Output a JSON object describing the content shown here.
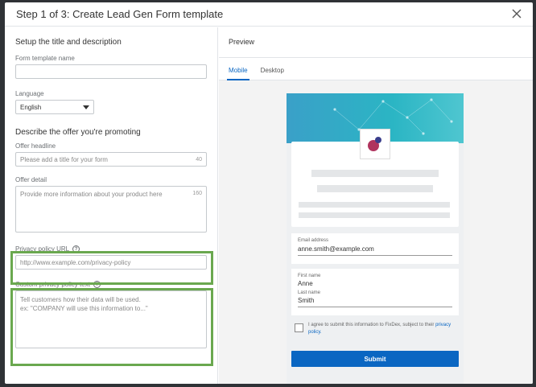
{
  "modal": {
    "title": "Step 1 of 3: Create Lead Gen Form template"
  },
  "left": {
    "section1_title": "Setup the title and description",
    "form_name_label": "Form template name",
    "form_name_value": "",
    "language_label": "Language",
    "language_value": "English",
    "section2_title": "Describe the offer you're promoting",
    "headline_label": "Offer headline",
    "headline_placeholder": "Please add a title for your form",
    "headline_counter": "40",
    "detail_label": "Offer detail",
    "detail_placeholder": "Provide more information about your product here",
    "detail_counter": "160",
    "privacy_url_label": "Privacy policy URL",
    "privacy_url_placeholder": "http://www.example.com/privacy-policy",
    "custom_privacy_label": "Custom privacy policy text",
    "custom_privacy_line1": "Tell customers how their data will be used.",
    "custom_privacy_line2": "ex: \"COMPANY will use this information to...\""
  },
  "preview": {
    "title": "Preview",
    "tabs": [
      "Mobile",
      "Desktop"
    ],
    "active_tab": "Mobile",
    "email_label": "Email address",
    "email_value": "anne.smith@example.com",
    "first_name_label": "First name",
    "first_name_value": "Anne",
    "last_name_label": "Last name",
    "last_name_value": "Smith",
    "consent_text": "I agree to submit this information to FixDex, subject to their",
    "consent_link": "privacy policy.",
    "submit_label": "Submit"
  },
  "colors": {
    "accent": "#0a66c2",
    "highlight": "#6aa84f"
  }
}
